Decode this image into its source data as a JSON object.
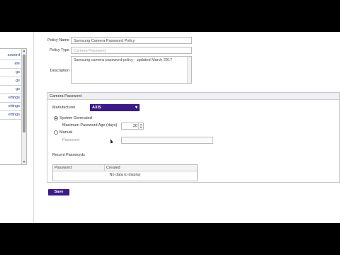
{
  "sidebar": {
    "items": [
      "ssword",
      "ate",
      "gs",
      "gs",
      "gs",
      "ettings",
      "ettings",
      "ettings"
    ]
  },
  "form": {
    "policy_name_label": "Policy Name",
    "policy_name_value": "Samsung Camera Password Policy",
    "policy_type_label": "Policy Type",
    "policy_type_value": "Camera Password",
    "description_label": "Description",
    "description_value": "Samsung camera password policy - updated March 2017"
  },
  "camera_password": {
    "header": "Camera Password",
    "manufacturer_label": "Manufacturer",
    "manufacturer_value": "AXIS",
    "system_generated_label": "System Generated",
    "max_age_label": "Maximum Password Age (days)",
    "max_age_value": "30",
    "manual_label": "Manual",
    "password_label": "Password",
    "recent_passwords_label": "Recent Passwords",
    "grid_columns": [
      "Password",
      "Created"
    ],
    "grid_empty": "No data to display"
  },
  "actions": {
    "save_label": "Save"
  },
  "colors": {
    "accent": "#3b1a8c",
    "link": "#2a3b8f"
  }
}
